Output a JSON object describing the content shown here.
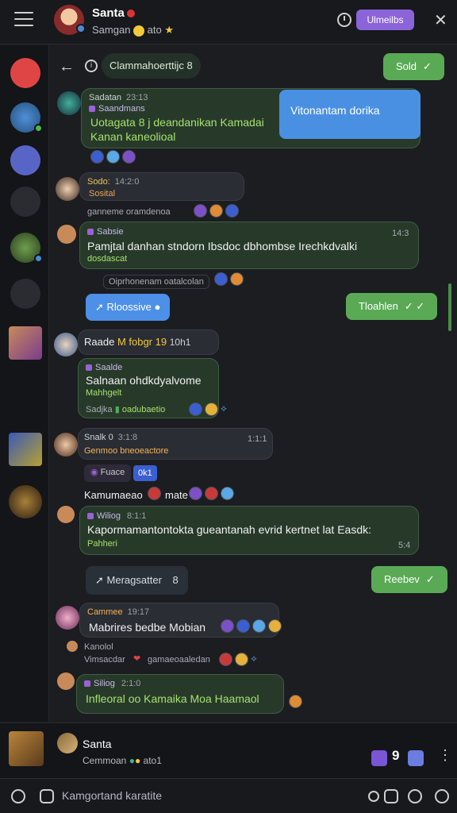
{
  "header": {
    "name": "Santa",
    "subtitle": "Samgan",
    "subtitle_suffix": "ato",
    "action_button": "Ulmeilbs"
  },
  "channel": {
    "pill": "Clammahoerttijc 8"
  },
  "messages": {
    "sent1": "Sold",
    "m1_header": "Sadatan",
    "m1_time": "23:13",
    "m1_tag": "Saandmans",
    "m1_body": "Uotagata 8 j deandanikan Kamadai Kanan kaneolioal",
    "m1_card": "Vitonantam dorika",
    "m2_header": "Sodo:",
    "m2_time": "14:2:0",
    "m2_sub": "Sosital",
    "m2_meta": "ganneme oramdenoa",
    "m3_tag": "Sabsie",
    "m3_time": "14:3",
    "m3_body": "Pamjtal danhan stndorn Ibsdoc dbhombse Irechkdvalki",
    "m3_sub": "dosdascat",
    "m3_meta": "Oiprhonenam oatalcolan",
    "recv_pill": "Rloossive",
    "sent2": "Tloahlen",
    "m4_header": "Raade",
    "m4_highlight": "M fobgr 19",
    "m4_time": "10h1",
    "m5_tag": "Saalde",
    "m5_body": "Salnaan ohdkdyalvome",
    "m5_sub": "Mahhgelt",
    "m5_meta1": "Sadjka",
    "m5_meta2": "oadubaetio",
    "m6_header": "Snalk 0",
    "m6_time": "3:1:8",
    "m6_time2": "1:1:1",
    "m6_sub": "Genmoo bneoeactore",
    "m6_pill": "Fuace",
    "m6_pill2": "0k1",
    "m7_line": "Kamumaeao",
    "m7_line2": "mate",
    "m8_tag": "Wiliog",
    "m8_time": "8:1:1",
    "m8_body": "Kapormamantontokta gueantanah evrid kertnet lat Easdk:",
    "m8_sub": "Pahheri",
    "m8_time2": "5:4",
    "dark_pill": "Meragsatter",
    "dark_pill_num": "8",
    "sent3": "Reebev",
    "m9_header": "Cammee",
    "m9_time": "19:17",
    "m9_body": "Mabrires bedbe Mobian",
    "m9_line1": "Kanolol",
    "m9_line2": "Vimsacdar",
    "m9_line3": "gamaeoaaledan",
    "m10_tag": "Siliog",
    "m10_time": "2:1:0",
    "m10_body": "Infleoral oo Kamaika Moa Haamaol"
  },
  "dm": {
    "name": "Santa",
    "sub": "Cemmoan",
    "sub_suffix": "ato1",
    "count": "9"
  },
  "compose": {
    "placeholder": "Kamgortand karatite"
  }
}
